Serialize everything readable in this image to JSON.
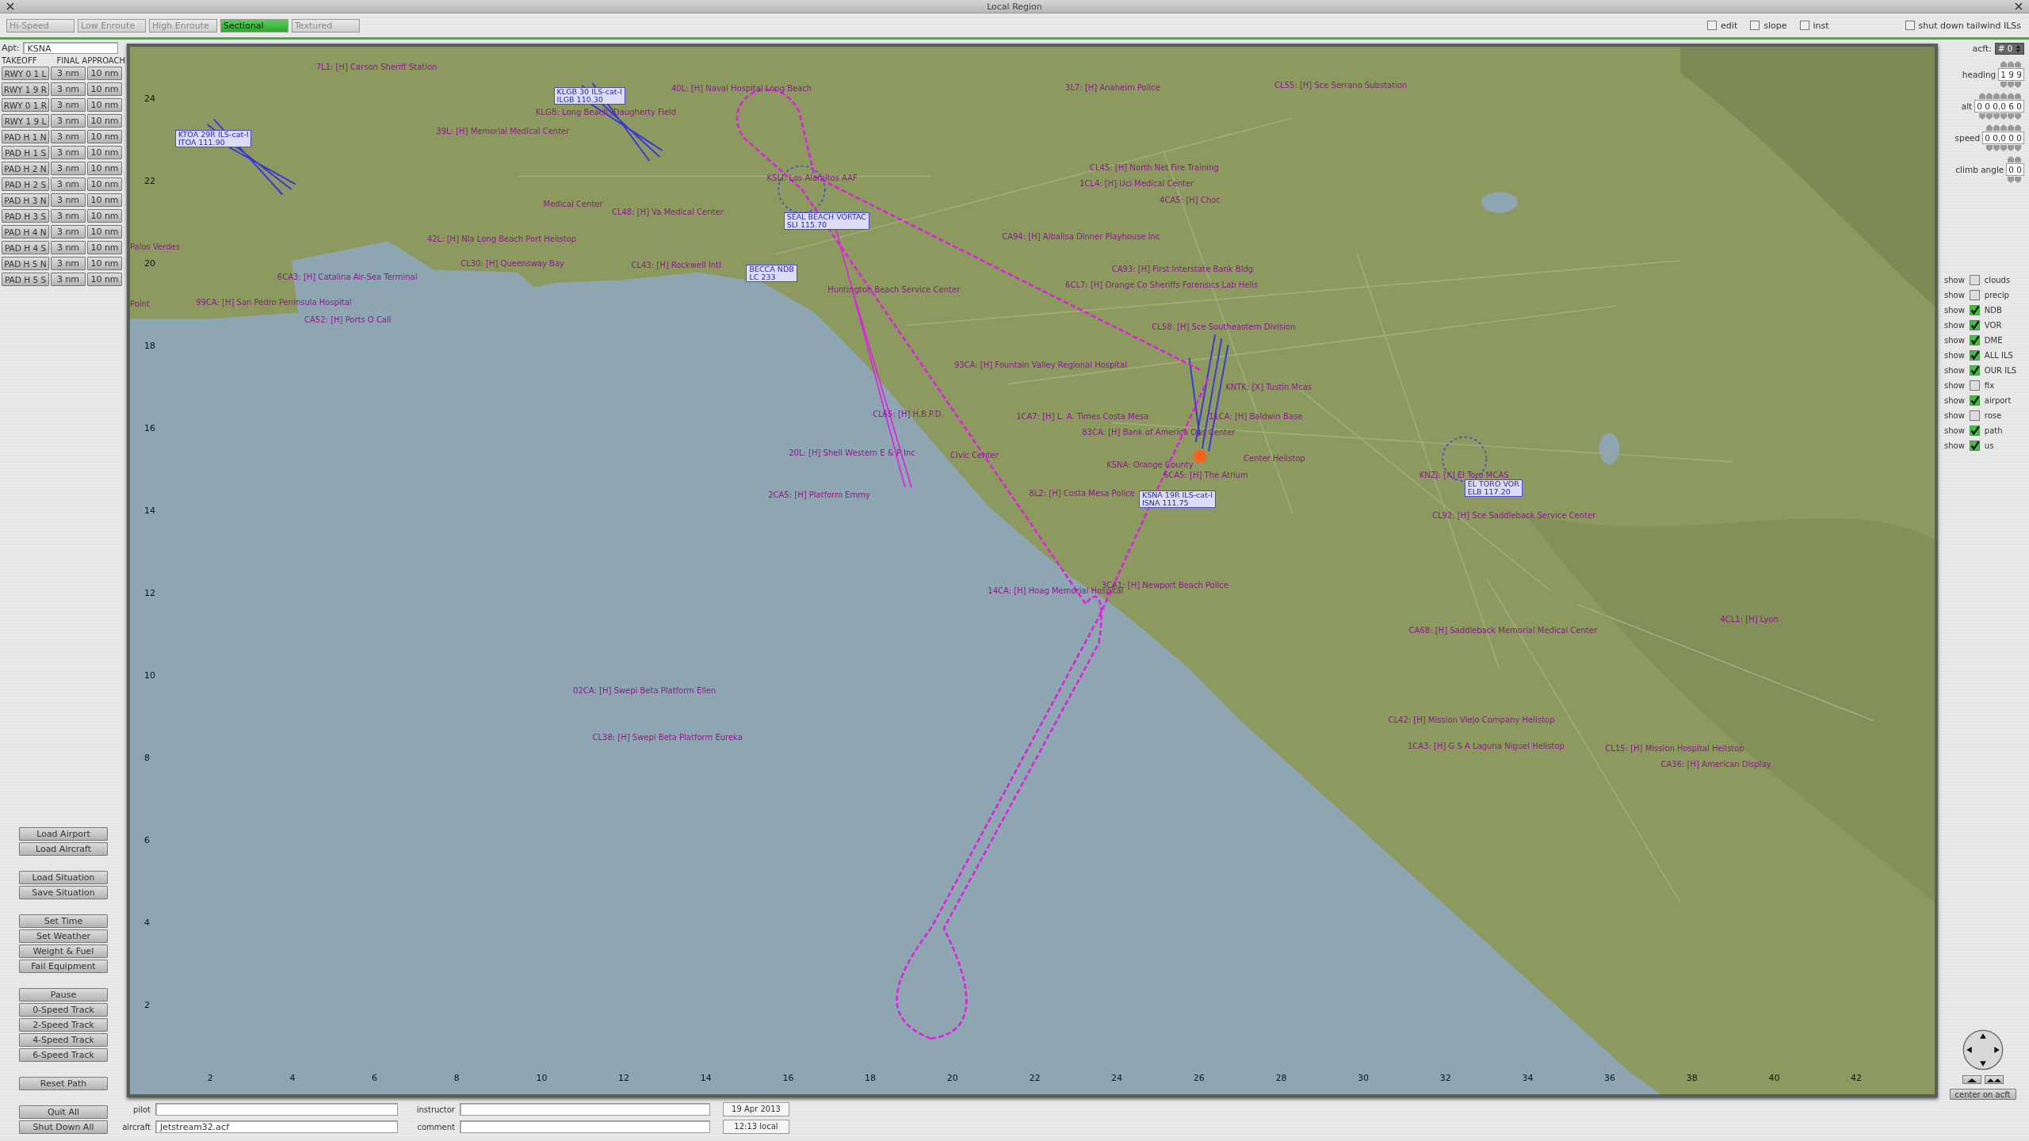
{
  "window": {
    "title": "Local Region"
  },
  "tabs": [
    {
      "label": "Hi-Speed",
      "selected": false
    },
    {
      "label": "Low Enroute",
      "selected": false
    },
    {
      "label": "High Enroute",
      "selected": false
    },
    {
      "label": "Sectional",
      "selected": true
    },
    {
      "label": "Textured",
      "selected": false
    }
  ],
  "toolbar_options": [
    {
      "label": "edit",
      "checked": false
    },
    {
      "label": "slope",
      "checked": false
    },
    {
      "label": "inst",
      "checked": false
    },
    {
      "label": "shut down tailwind ILSs",
      "checked": false
    }
  ],
  "airport": {
    "label": "Apt:",
    "value": "KSNA"
  },
  "runway_headers": [
    "TAKEOFF",
    "FINAL APPROACH"
  ],
  "runways": [
    {
      "name": "RWY 0 1 L",
      "short": "3 nm",
      "long": "10 nm"
    },
    {
      "name": "RWY 1 9 R",
      "short": "3 nm",
      "long": "10 nm"
    },
    {
      "name": "RWY 0 1 R",
      "short": "3 nm",
      "long": "10 nm"
    },
    {
      "name": "RWY 1 9 L",
      "short": "3 nm",
      "long": "10 nm"
    },
    {
      "name": "PAD H 1 N",
      "short": "3 nm",
      "long": "10 nm"
    },
    {
      "name": "PAD H 1 S",
      "short": "3 nm",
      "long": "10 nm"
    },
    {
      "name": "PAD H 2 N",
      "short": "3 nm",
      "long": "10 nm"
    },
    {
      "name": "PAD H 2 S",
      "short": "3 nm",
      "long": "10 nm"
    },
    {
      "name": "PAD H 3 N",
      "short": "3 nm",
      "long": "10 nm"
    },
    {
      "name": "PAD H 3 S",
      "short": "3 nm",
      "long": "10 nm"
    },
    {
      "name": "PAD H 4 N",
      "short": "3 nm",
      "long": "10 nm"
    },
    {
      "name": "PAD H 4 S",
      "short": "3 nm",
      "long": "10 nm"
    },
    {
      "name": "PAD H 5 N",
      "short": "3 nm",
      "long": "10 nm"
    },
    {
      "name": "PAD H 5 S",
      "short": "3 nm",
      "long": "10 nm"
    }
  ],
  "command_groups": [
    [
      "Load Airport",
      "Load Aircraft"
    ],
    [
      "Load Situation",
      "Save Situation"
    ],
    [
      "Set Time",
      "Set Weather",
      "Weight & Fuel",
      "Fail Equipment"
    ],
    [
      "Pause",
      "0-Speed Track",
      "2-Speed Track",
      "4-Speed Track",
      "6-Speed Track"
    ],
    [
      "Reset Path"
    ],
    [
      "Quit All",
      "Shut Down All"
    ]
  ],
  "map": {
    "x_ticks": [
      "2",
      "4",
      "6",
      "8",
      "10",
      "12",
      "14",
      "16",
      "18",
      "20",
      "22",
      "24",
      "26",
      "28",
      "30",
      "32",
      "34",
      "36",
      "38",
      "40",
      "42"
    ],
    "y_ticks": [
      "24",
      "22",
      "20",
      "18",
      "16",
      "14",
      "12",
      "10",
      "8",
      "6",
      "4",
      "2"
    ],
    "labels": [
      {
        "text": "7L1: [H] Carson Sheriff Station"
      },
      {
        "text": "40L: [H] Naval Hospital Long Beach"
      },
      {
        "text": "3L7: [H] Anaheim Police"
      },
      {
        "text": "CL55: [H] Sce Serrano Substation"
      },
      {
        "text": "KLGB: Long Beach /Daugherty Field"
      },
      {
        "text": "39L: [H] Memorial Medical Center"
      },
      {
        "text": "KSLI: Los Alamitos AAF"
      },
      {
        "text": "CL45: [H] North Net Fire Training"
      },
      {
        "text": "1CL4: [H] Uci Medical Center"
      },
      {
        "text": "Medical Center"
      },
      {
        "text": "4CA5: [H] Choc"
      },
      {
        "text": "CL48: [H] Va Medical Center"
      },
      {
        "text": "42L: [H] Nla Long Beach Port Helistop"
      },
      {
        "text": "CA94: [H] Albalisa Dinner Playhouse Inc"
      },
      {
        "text": "Palos Verdes"
      },
      {
        "text": "CL30: [H] Queensway Bay"
      },
      {
        "text": "CL43: [H] Rockwell Intl"
      },
      {
        "text": "CA93: [H] First Interstate Bank Bldg"
      },
      {
        "text": "6CA3: [H] Catalina Air-Sea Terminal"
      },
      {
        "text": "6CL7: [H] Orange Co Sheriffs Forensics Lab Helis"
      },
      {
        "text": "Huntington Beach Service Center"
      },
      {
        "text": "Point"
      },
      {
        "text": "99CA: [H] San Pedro Peninsula Hospital"
      },
      {
        "text": "CA52: [H] Ports O Call"
      },
      {
        "text": "CL58: [H] Sce Southeastern Division"
      },
      {
        "text": "93CA: [H] Fountain Valley Regional Hospital"
      },
      {
        "text": "KNTK: [X] Tustin Mcas"
      },
      {
        "text": "CL65: [H] H.B.P.D."
      },
      {
        "text": "1CA7: [H] L. A. Times Costa Mesa"
      },
      {
        "text": "11CA: [H] Baldwin Base"
      },
      {
        "text": "83CA: [H] Bank of America Ops Center"
      },
      {
        "text": "20L: [H] Shell Western E & P Inc"
      },
      {
        "text": "Civic Center"
      },
      {
        "text": "KSNA: Orange County"
      },
      {
        "text": "Center Helistop"
      },
      {
        "text": "6CA5: [H] The Atrium"
      },
      {
        "text": "KNZJ: [X] El Toro MCAS"
      },
      {
        "text": "2CA5: [H] Platform Emmy"
      },
      {
        "text": "8L2: [H] Costa Mesa Police"
      },
      {
        "text": "CL92: [H] Sce Saddleback Service Center"
      },
      {
        "text": "14CA: [H] Hoag Memorial Hospital"
      },
      {
        "text": "3CA1: [H] Newport Beach Police"
      },
      {
        "text": "4CL1: [H] Lyon"
      },
      {
        "text": "CA68: [H] Saddleback Memorial Medical Center"
      },
      {
        "text": "02CA: [H] Swepi Beta Platform Ellen"
      },
      {
        "text": "CL42: [H] Mission Viejo Company Helistop"
      },
      {
        "text": "CL38: [H] Swepi Beta Platform Eureka"
      },
      {
        "text": "1CA3: [H] G S A Laguna Niguel Helistop"
      },
      {
        "text": "CL15: [H] Mission Hospital Helistop"
      },
      {
        "text": "CA36: [H] American Display"
      }
    ],
    "navaids": [
      {
        "name": "KLGB 30 ILS-cat-I",
        "frequency": "ILGB 110.30"
      },
      {
        "name": "KTOA 29R ILS-cat-I",
        "frequency": "ITOA 111.90"
      },
      {
        "name": "SEAL BEACH VORTAC",
        "frequency": "SLI 115.70"
      },
      {
        "name": "BECCA NDB",
        "frequency": "LC 233"
      },
      {
        "name": "KSNA 19R ILS-cat-I",
        "frequency": "ISNA 111.75"
      },
      {
        "name": "EL TORO VOR",
        "frequency": "ELB 117.20"
      }
    ]
  },
  "aircraft_panel": {
    "label": "acft:",
    "value": "# 0",
    "fields": [
      {
        "label": "heading",
        "value": "1 9 9"
      },
      {
        "label": "alt",
        "value": "0 0 0,0 6 0"
      },
      {
        "label": "speed",
        "value": "0 0,0 0 0"
      },
      {
        "label": "climb angle",
        "value": "0 0"
      }
    ]
  },
  "layers": [
    {
      "prefix": "show",
      "label": "clouds",
      "checked": false
    },
    {
      "prefix": "show",
      "label": "precip",
      "checked": false
    },
    {
      "prefix": "show",
      "label": "NDB",
      "checked": true
    },
    {
      "prefix": "show",
      "label": "VOR",
      "checked": true
    },
    {
      "prefix": "show",
      "label": "DME",
      "checked": true
    },
    {
      "prefix": "show",
      "label": "ALL ILS",
      "checked": true
    },
    {
      "prefix": "show",
      "label": "OUR ILS",
      "checked": true
    },
    {
      "prefix": "show",
      "label": "fix",
      "checked": false
    },
    {
      "prefix": "show",
      "label": "airport",
      "checked": true
    },
    {
      "prefix": "show",
      "label": "rose",
      "checked": false
    },
    {
      "prefix": "show",
      "label": "path",
      "checked": true
    },
    {
      "prefix": "show",
      "label": "us",
      "checked": true
    }
  ],
  "center_button": "center on acft",
  "session": {
    "fields": [
      {
        "label": "pilot"
      },
      {
        "label": "instructor"
      },
      {
        "label": "aircraft",
        "value": "Jetstream32.acf"
      },
      {
        "label": "comment"
      }
    ],
    "date": "19 Apr 2013",
    "time": "12:13 local"
  }
}
